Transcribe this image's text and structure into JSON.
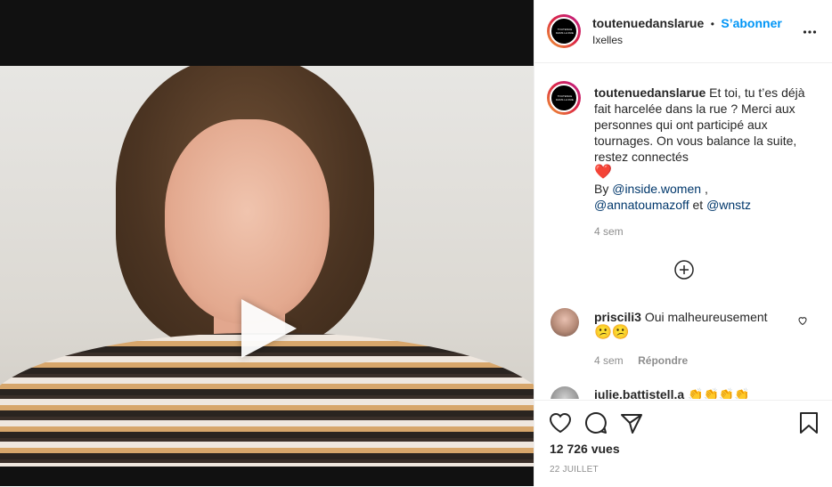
{
  "post": {
    "username": "toutenuedanslarue",
    "follow_label": "S’abonner",
    "location": "Ixelles",
    "avatar_text": "TOUTENUE DANS LA RUE",
    "caption_text": "Et toi, tu t’es déjà fait harcelée dans la rue ? Merci aux personnes qui ont participé aux tournages. On vous balance la suite, restez connectés",
    "caption_emoji": "❤️",
    "credits_prefix": "By",
    "mention_1": "@inside.women",
    "credits_sep_1": ",",
    "mention_2": "@annatoumazoff",
    "credits_sep_2": "et",
    "mention_3": "@wnstz",
    "caption_age": "4 sem"
  },
  "comments": [
    {
      "username": "priscili3",
      "text": "Oui malheureusement",
      "emoji": "😕😕",
      "age": "4 sem",
      "reply_label": "Répondre"
    },
    {
      "username": "julie.battistell.a",
      "emoji": "👏👏👏👏"
    }
  ],
  "stats": {
    "views": "12 726 vues",
    "date": "22 JUILLET"
  },
  "icons": {
    "more": "more-icon",
    "load_more": "plus-circle-icon",
    "like": "heart-icon",
    "comment": "comment-icon",
    "share": "paper-plane-icon",
    "save": "bookmark-icon",
    "play": "play-icon"
  }
}
